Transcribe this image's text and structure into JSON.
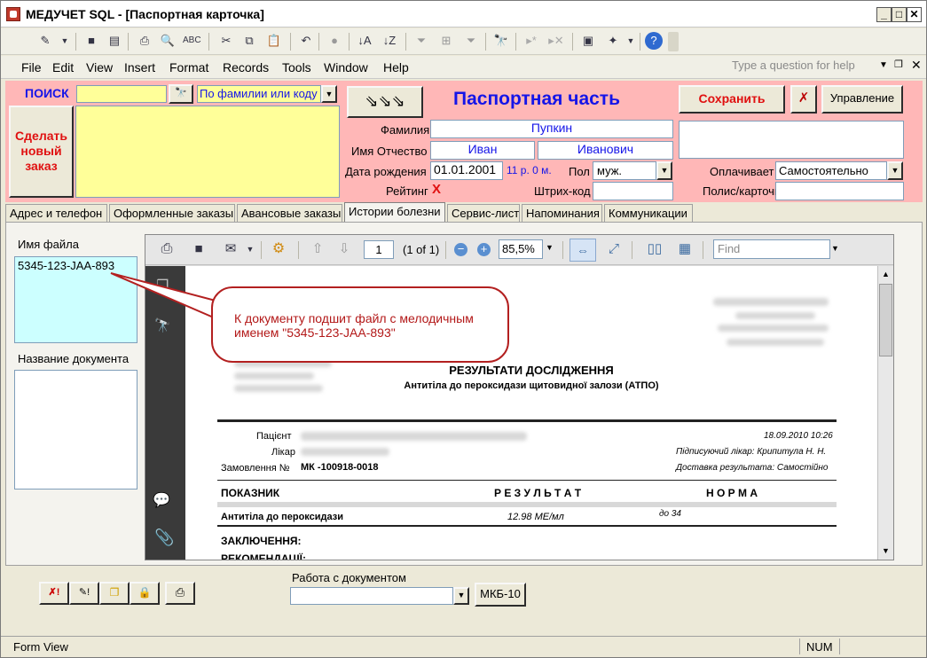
{
  "window": {
    "title": "МЕДУЧЕТ SQL - [Паспортная карточка]"
  },
  "menu": [
    "File",
    "Edit",
    "View",
    "Insert",
    "Format",
    "Records",
    "Tools",
    "Window",
    "Help"
  ],
  "help_placeholder": "Type a question for help",
  "search": {
    "label": "ПОИСК",
    "mode": "По фамилии или коду"
  },
  "new_order_button": "Сделать новый заказ",
  "header": {
    "section_title": "Паспортная часть",
    "save_button": "Сохранить",
    "manage_button": "Управление",
    "surname_label": "Фамилия",
    "surname": "Пупкин",
    "name_label": "Имя Отчество",
    "first_name": "Иван",
    "patronymic": "Иванович",
    "dob_label": "Дата рождения",
    "dob": "01.01.2001",
    "age": "11 р. 0 м.",
    "sex_label": "Пол",
    "sex": "муж.",
    "rating_label": "Рейтинг",
    "rating_value": "X",
    "barcode_label": "Штрих-код",
    "payer_label": "Оплачивает",
    "payer": "Самостоятельно",
    "policy_label": "Полис/карточка"
  },
  "tabs": [
    "Адрес и телефон",
    "Оформленные заказы",
    "Авансовые заказы",
    "Истории болезни",
    "Сервис-лист",
    "Напоминания",
    "Коммуникации"
  ],
  "files": {
    "label": "Имя файла",
    "items": [
      "5345-123-JAA-893"
    ],
    "doc_name_label": "Название документа"
  },
  "viewer": {
    "page_number": "1",
    "page_of": "(1 of 1)",
    "zoom": "85,5%",
    "find_placeholder": "Find",
    "doc": {
      "title": "РЕЗУЛЬТАТИ ДОСЛІДЖЕННЯ",
      "subtitle": "Антитіла до пероксидази щитовидної залози (АТПО)",
      "patient_label": "Пацієнт",
      "doctor_label": "Лікар",
      "order_label": "Замовлення №",
      "order_number": "МК -100918-0018",
      "datetime": "18.09.2010 10:26",
      "signer": "Підписуючий лікар: Крипитула Н. Н.",
      "delivery": "Доставка результата: Самостійно",
      "col_indicator": "ПОКАЗНИК",
      "col_result": "Р Е З У Л Ь Т А Т",
      "col_norm": "Н О Р М А",
      "row_name": "Антитіла до пероксидази",
      "row_result": "12.98 МЕ/мл",
      "row_norm": "до 34",
      "conclusion": "ЗАКЛЮЧЕННЯ:",
      "recommend": "РЕКОМЕНДАЦІЇ:"
    }
  },
  "callout": "К документу подшит файл с мелодичным именем \"5345-123-JAA-893\"",
  "bottom": {
    "doc_work_label": "Работа с документом",
    "icd_button": "МКБ-10"
  },
  "status": {
    "left": "Form View",
    "num": "NUM"
  }
}
